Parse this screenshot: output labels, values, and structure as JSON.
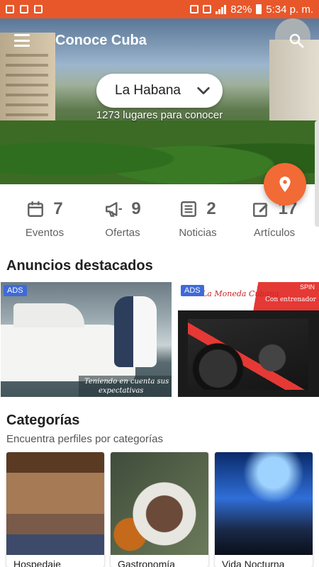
{
  "status_bar": {
    "battery": "82%",
    "time": "5:34 p. m."
  },
  "app": {
    "title": "Conoce Cuba"
  },
  "city": {
    "selected": "La Habana",
    "places_count": "1273 lugares para conocer"
  },
  "stats": [
    {
      "icon": "calendar-icon",
      "value": "7",
      "label": "Eventos"
    },
    {
      "icon": "megaphone-icon",
      "value": "9",
      "label": "Ofertas"
    },
    {
      "icon": "newspaper-icon",
      "value": "2",
      "label": "Noticias"
    },
    {
      "icon": "edit-icon",
      "value": "17",
      "label": "Artículos"
    }
  ],
  "featured": {
    "title": "Anuncios destacados",
    "ads": [
      {
        "badge": "ADS",
        "caption_line1": "Teniendo en cuenta sus",
        "caption_line2": "expectativas"
      },
      {
        "badge": "ADS",
        "brand": "La Moneda Cubana",
        "tag": "SPIN",
        "subtitle": "Con entrenador"
      }
    ]
  },
  "categories": {
    "title": "Categorías",
    "subtitle": "Encuentra perfiles por categorías",
    "items": [
      {
        "name": "Hospedaje"
      },
      {
        "name": "Gastronomía"
      },
      {
        "name": "Vida Nocturna"
      }
    ]
  },
  "colors": {
    "accent": "#e8572a",
    "fab": "#f26a35",
    "ads_badge": "#3f6ad8"
  }
}
